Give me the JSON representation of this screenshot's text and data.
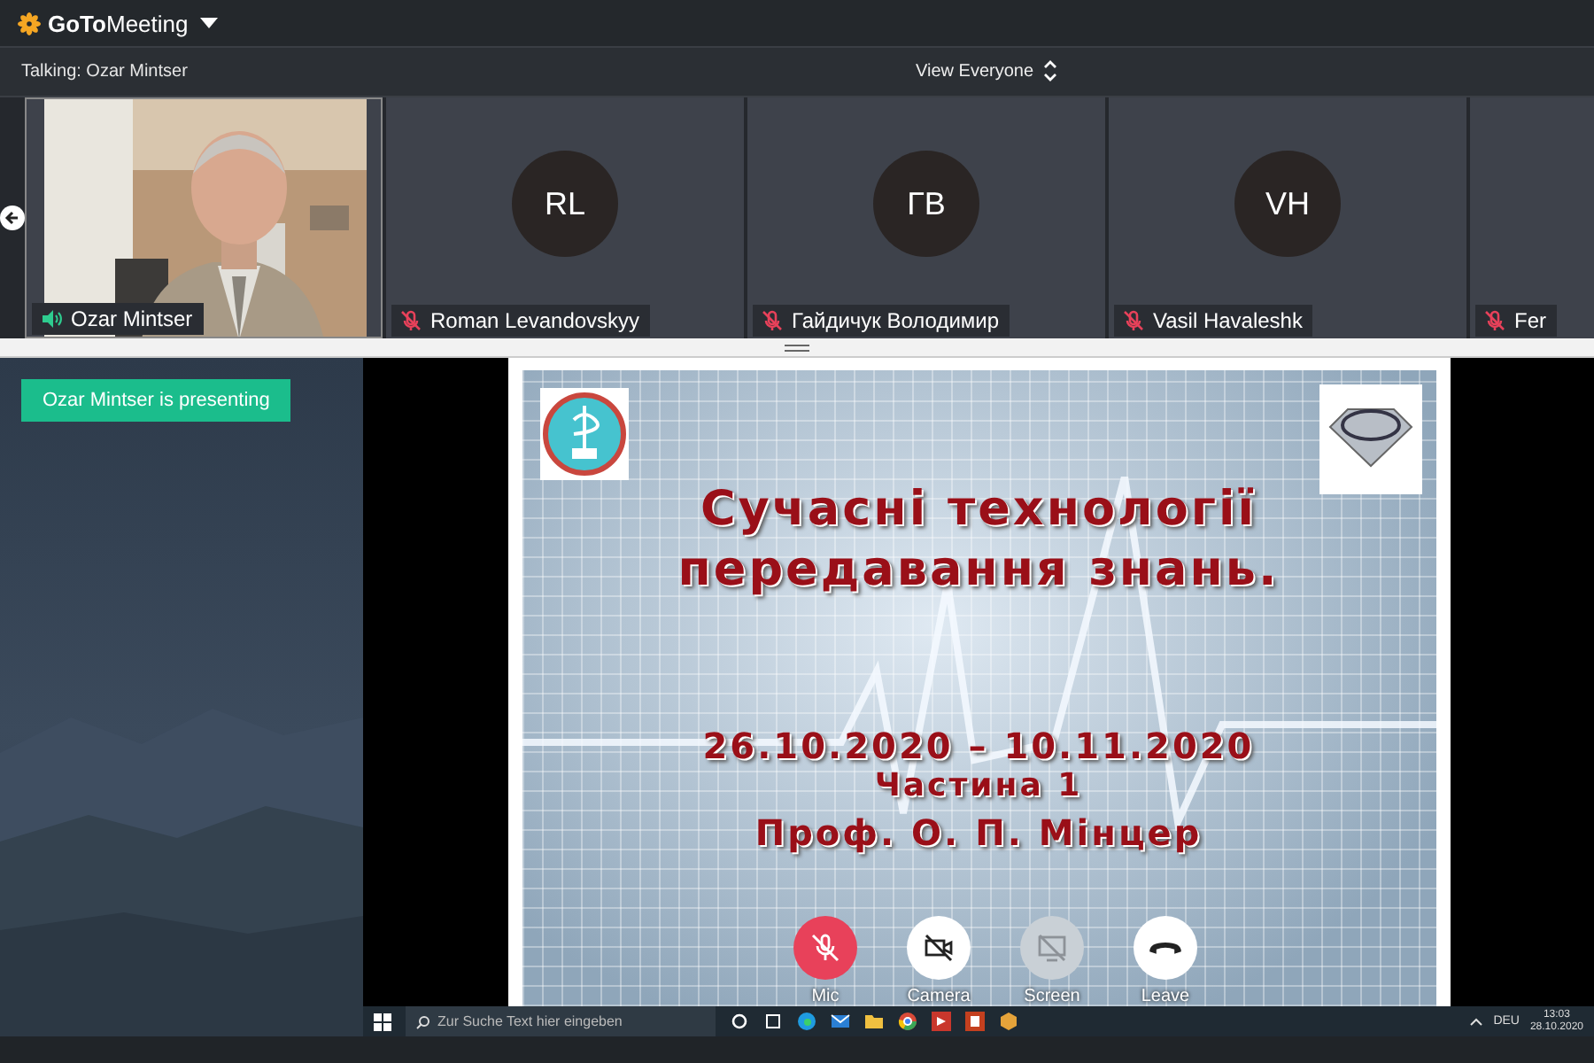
{
  "app": {
    "name_prefix": "GoTo",
    "name_suffix": "Meeting"
  },
  "info_bar": {
    "talking": "Talking: Ozar Mintser",
    "view": "View Everyone"
  },
  "participants": [
    {
      "kind": "video",
      "name": "Ozar Mintser",
      "muted": false,
      "talking": true
    },
    {
      "kind": "avatar",
      "initials": "RL",
      "name": "Roman Levandovskyy",
      "muted": true,
      "talking": false
    },
    {
      "kind": "avatar",
      "initials": "ГВ",
      "name": "Гайдичук Володимир",
      "muted": true,
      "talking": false
    },
    {
      "kind": "avatar",
      "initials": "VH",
      "name": "Vasil Havaleshk",
      "muted": true,
      "talking": false
    },
    {
      "kind": "avatar",
      "name": "Fer",
      "muted": true,
      "talking": false
    }
  ],
  "presenter_badge": "Ozar Mintser is presenting",
  "slide": {
    "title_lines": [
      "Сучасні технології",
      "передавання знань."
    ],
    "dates": "26.10.2020 – 10.11.2020",
    "part": "Частина 1",
    "author": "Проф. О. П. Мінцер"
  },
  "controls": [
    {
      "kind": "mic",
      "label": "Mic",
      "off": true,
      "disabled": false
    },
    {
      "kind": "camera",
      "label": "Camera",
      "off": true,
      "disabled": false
    },
    {
      "kind": "screen",
      "label": "Screen",
      "off": true,
      "disabled": true
    },
    {
      "kind": "leave",
      "label": "Leave",
      "off": false,
      "disabled": false
    }
  ],
  "taskbar": {
    "search_placeholder": "Zur Suche Text hier eingeben",
    "language": "DEU",
    "time": "13:03",
    "date": "28.10.2020"
  }
}
